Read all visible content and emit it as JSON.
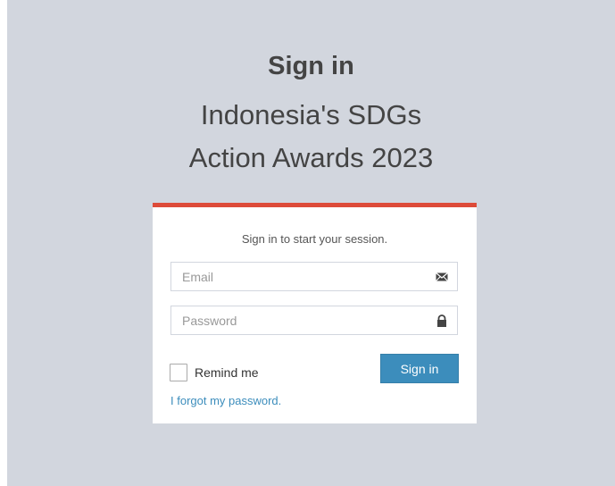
{
  "header": {
    "title": "Sign in",
    "subtitle_line1": "Indonesia's SDGs",
    "subtitle_line2": "Action Awards 2023"
  },
  "login": {
    "message": "Sign in to start your session.",
    "email_placeholder": "Email",
    "password_placeholder": "Password",
    "remember_label": "Remind me",
    "signin_label": "Sign in",
    "forgot_label": "I forgot my password.",
    "email_icon": "envelope-icon",
    "password_icon": "lock-icon"
  },
  "colors": {
    "background": "#d2d6de",
    "accent_border": "#dd4b39",
    "primary_button": "#3c8dbc",
    "link": "#3c8dbc"
  }
}
